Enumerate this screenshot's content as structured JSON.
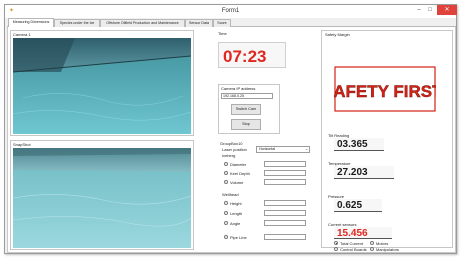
{
  "window": {
    "title": "Form1"
  },
  "tabs": [
    {
      "label": "Measuring Dimensions"
    },
    {
      "label": "Species under the Ice"
    },
    {
      "label": "Offshore Oilfield Production and Maintenance"
    },
    {
      "label": "Sensor Data"
    },
    {
      "label": "Score"
    }
  ],
  "camera_panel": {
    "title": "Camera 1"
  },
  "snapshot_panel": {
    "title": "SnapShot"
  },
  "time": {
    "label": "Time",
    "value": "07:23",
    "color": "#e0261f"
  },
  "camera_ip": {
    "label": "Camera IP address",
    "value": "192.168.0.25",
    "switch_label": "Switch Cam",
    "stop_label": "Stop"
  },
  "measure": {
    "title": "GroupBox10",
    "laser_label": "Laser position",
    "laser_value": "Horizontal",
    "iceberg_label": "Iceberg",
    "options": [
      "Diameter",
      "Keel Depth",
      "Volume"
    ],
    "wellhead_label": "Wellhead",
    "wellhead_options": [
      "Height",
      "Length",
      "Angle"
    ],
    "pipeline_label": "Pipe Line"
  },
  "safety": {
    "title": "Safety Margin",
    "sign_text": "SAFETY FIRST!",
    "sign_color": "#d62216"
  },
  "readings": {
    "tilt_label": "Tilt Reading",
    "tilt_value": "03.365",
    "temp_label": "Temperature",
    "temp_value": "27.203",
    "pressure_label": "Pressure",
    "pressure_value": "0.625",
    "current_label": "Current sensors",
    "current_value": "15.456",
    "current_color": "#e0261f"
  },
  "current_options": {
    "total": "Total Current",
    "motors": "Motors",
    "control": "Control Boards",
    "manip": "Manipulators"
  },
  "window_buttons": {
    "minimize": "–",
    "maximize": "□",
    "close": "✕"
  },
  "icons": {
    "app": "app-icon"
  }
}
